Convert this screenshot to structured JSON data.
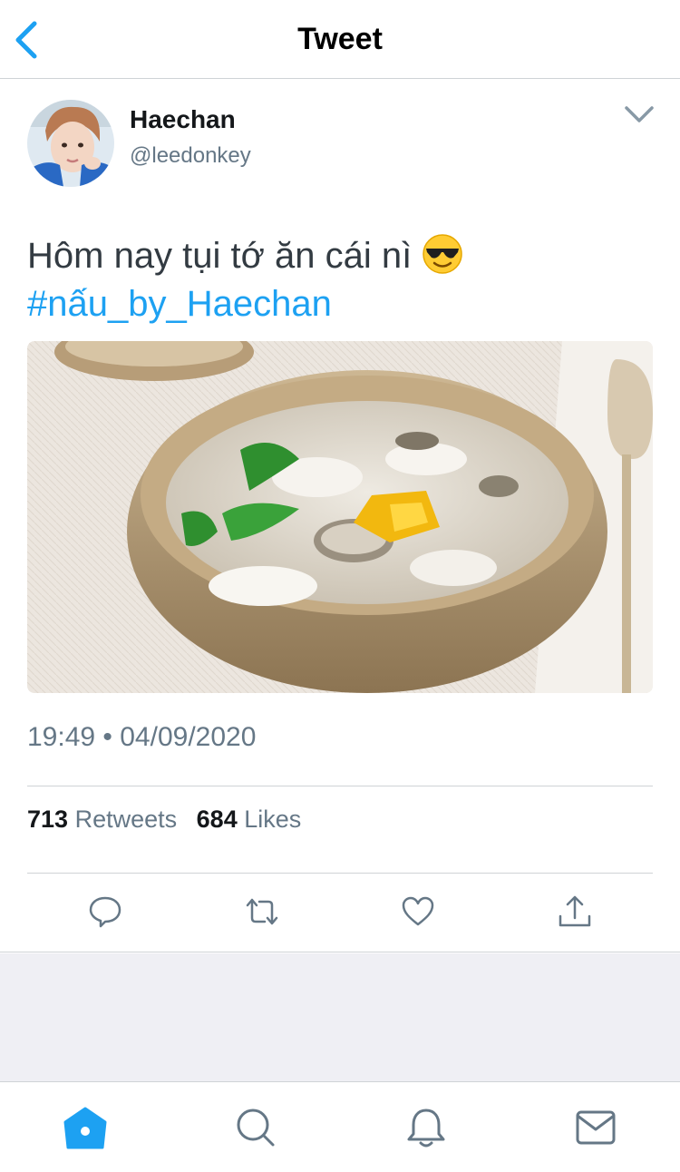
{
  "header": {
    "title": "Tweet",
    "back_icon": "chevron-left-icon"
  },
  "tweet": {
    "display_name": "Haechan",
    "handle": "@leedonkey",
    "text": "Hôm nay tụi tớ ăn cái nì ",
    "emoji": "smiling-face-with-sunglasses",
    "hashtag": "#nấu_by_Haechan",
    "timestamp": "19:49 • 04/09/2020",
    "retweets_count": "713",
    "retweets_label": "Retweets",
    "likes_count": "684",
    "likes_label": "Likes"
  },
  "actions": [
    "reply-icon",
    "retweet-icon",
    "like-icon",
    "share-icon"
  ],
  "tabbar": [
    "home-icon",
    "search-icon",
    "notifications-icon",
    "messages-icon"
  ],
  "colors": {
    "accent": "#1da1f2",
    "secondary_text": "#657786",
    "divider": "#cfd3d6",
    "background": "#efeff4"
  }
}
